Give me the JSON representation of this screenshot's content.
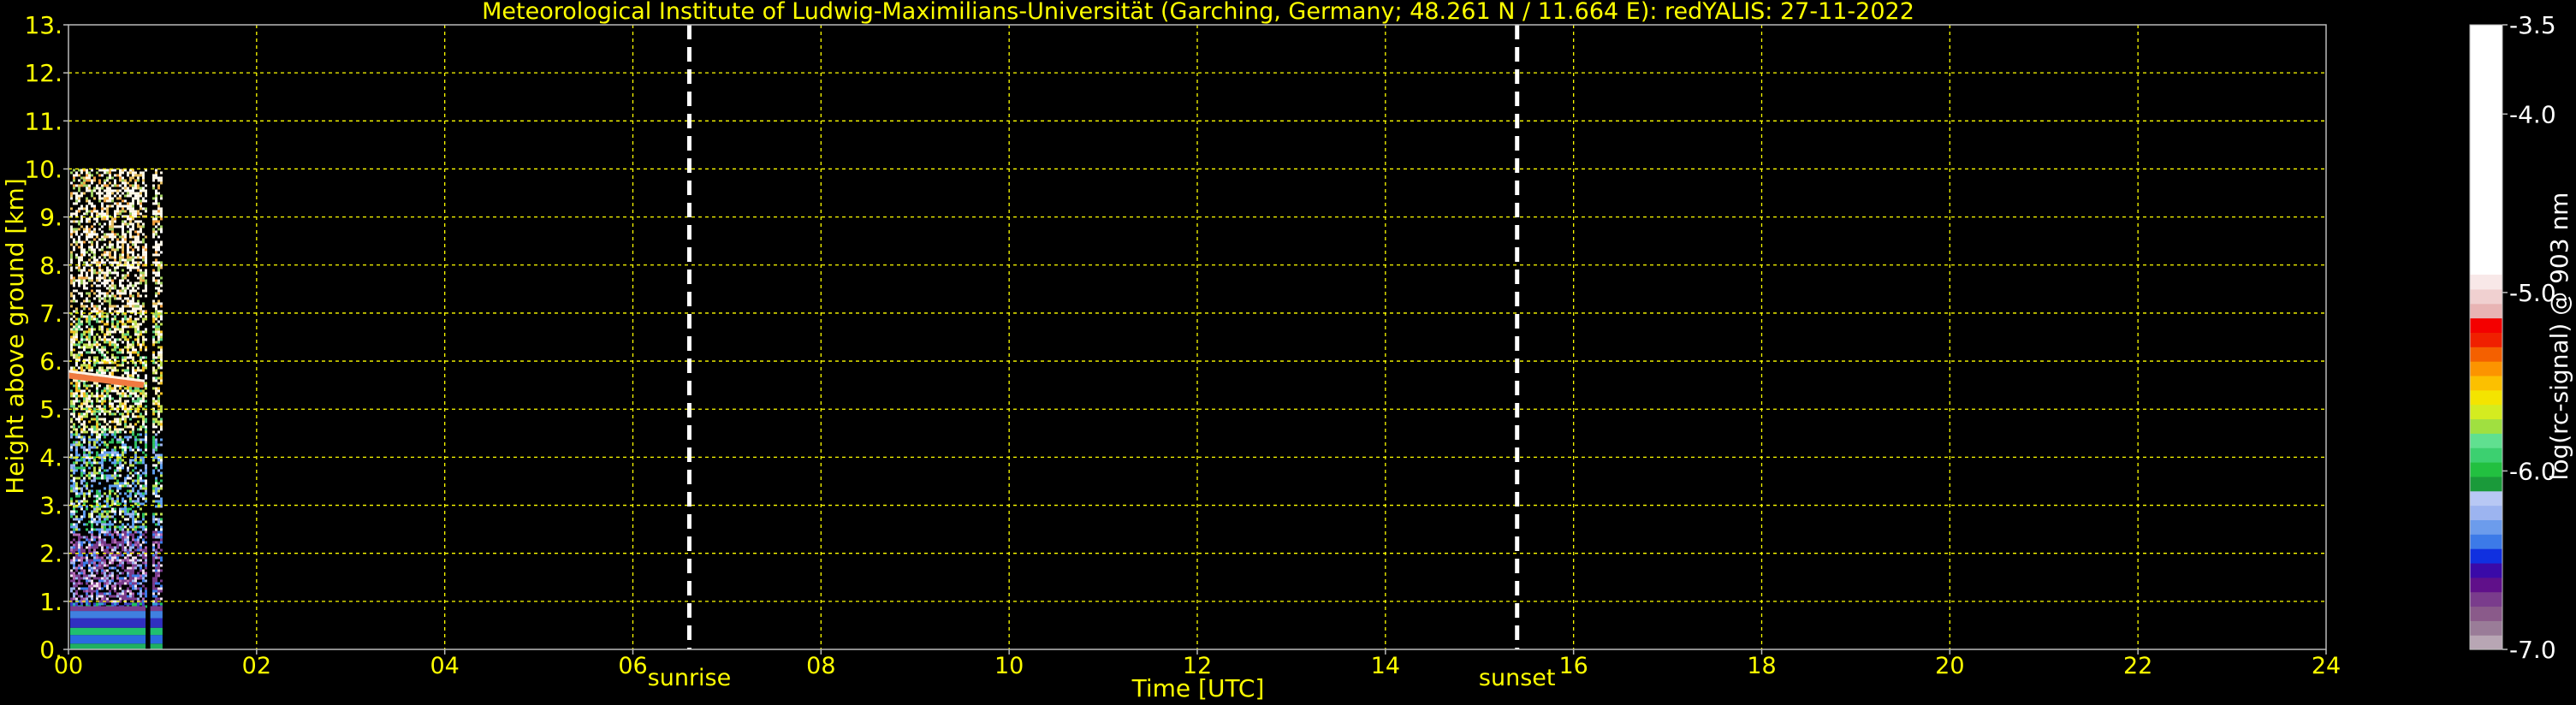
{
  "chart_data": {
    "type": "heatmap",
    "title": "Meteorological Institute of Ludwig-Maximilians-Universität (Garching, Germany; 48.261 N / 11.664 E):    redYALIS: 27-11-2022",
    "xlabel": "Time [UTC]",
    "ylabel": "Height above ground [km]",
    "xlim": [
      0,
      24
    ],
    "ylim": [
      0,
      13
    ],
    "x_ticks": [
      "00",
      "02",
      "04",
      "06",
      "08",
      "10",
      "12",
      "14",
      "16",
      "18",
      "20",
      "22",
      "24"
    ],
    "y_ticks": [
      "0.",
      "1.",
      "2.",
      "3.",
      "4.",
      "5.",
      "6.",
      "7.",
      "8.",
      "9.",
      "10.",
      "11.",
      "12.",
      "13."
    ],
    "grid": true,
    "events": [
      {
        "label": "sunrise",
        "time_utc_hours": 6.6
      },
      {
        "label": "sunset",
        "time_utc_hours": 15.4
      }
    ],
    "data_coverage": {
      "start_hours": 0.0,
      "end_hours": 1.0,
      "height_max_km": 10.0,
      "gap_hours": [
        0.82,
        0.87
      ]
    },
    "features": [
      {
        "name": "elevated layer",
        "start_hours": 0.0,
        "end_hours": 0.8,
        "height_km_start": 5.7,
        "height_km_end": 5.5
      },
      {
        "name": "boundary layer",
        "start_hours": 0.0,
        "end_hours": 1.0,
        "height_km_start": 0.0,
        "height_km_end": 0.9
      }
    ],
    "colorbar": {
      "label": "log(rc-signal) @ 903 nm",
      "range": [
        -7.0,
        -3.5
      ],
      "ticks": [
        "-3.5",
        "-4.0",
        "-5.0",
        "-6.0",
        "-7.0"
      ]
    },
    "colors": {
      "text": "#ffff00",
      "grid": "#ffff00",
      "event_line": "#ffffff",
      "colorbar_scale": [
        "#b8a6b4",
        "#9a7c98",
        "#8a5a8a",
        "#7a3c8c",
        "#60108a",
        "#3a0aa8",
        "#1030e0",
        "#3c7ae8",
        "#6c9cec",
        "#9cb4f0",
        "#b8c8f4",
        "#1a9a3a",
        "#22c040",
        "#3cd070",
        "#60e090",
        "#a0e040",
        "#d4ec20",
        "#f4e400",
        "#fcc000",
        "#fc9400",
        "#f46000",
        "#f02000",
        "#f40000",
        "#e8b4b4",
        "#f0d0d0",
        "#f8e8e8",
        "#ffffff"
      ]
    }
  }
}
